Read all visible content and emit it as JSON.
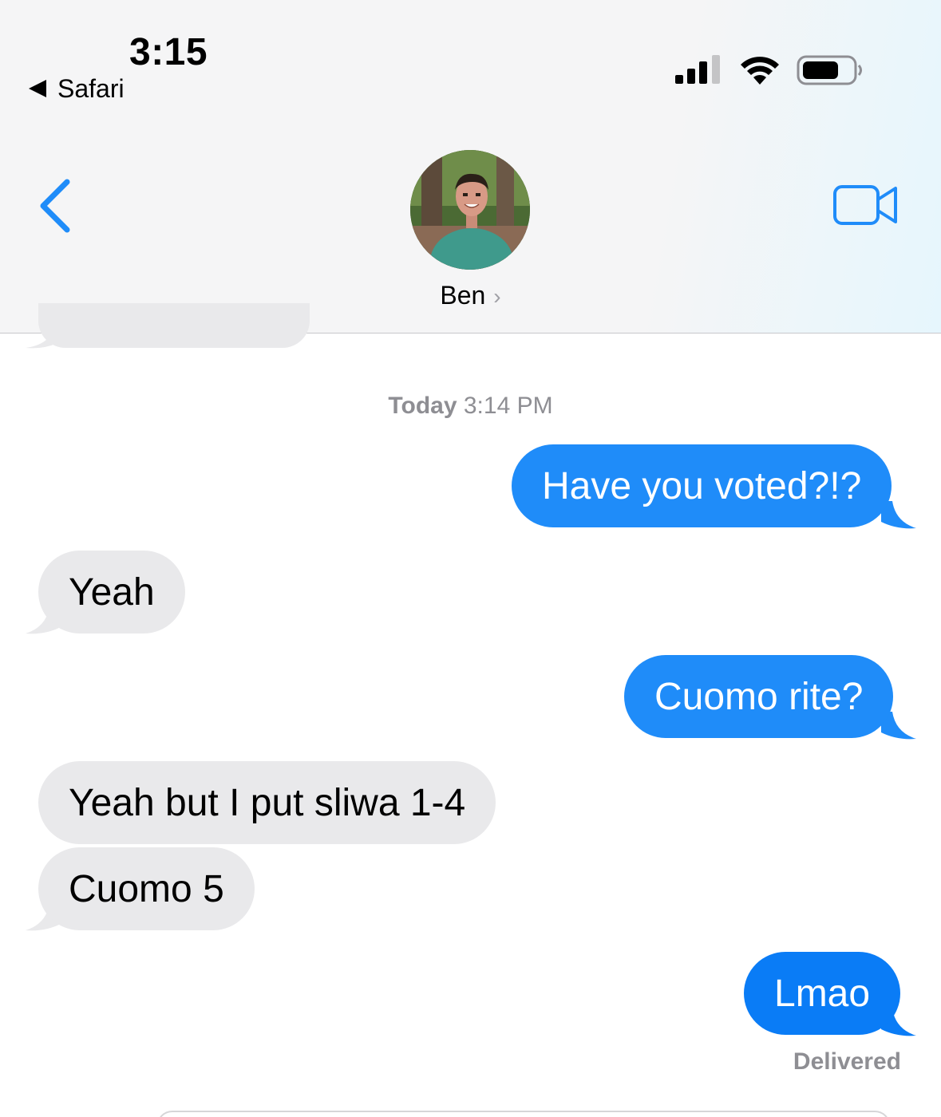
{
  "status_bar": {
    "time": "3:15",
    "back_app_label": "Safari",
    "icons": [
      "cellular-signal-icon",
      "wifi-icon",
      "battery-icon"
    ]
  },
  "nav": {
    "back_icon": "chevron-left-icon",
    "contact_name": "Ben",
    "contact_chevron": "›",
    "video_icon": "video-camera-icon"
  },
  "colors": {
    "accent": "#1f8cf9",
    "incoming_bubble": "#e9e9eb",
    "meta_text": "#8e8e93"
  },
  "conversation": {
    "timestamp_day": "Today",
    "timestamp_time": "3:14 PM",
    "messages": [
      {
        "direction": "outgoing",
        "text": "Have you voted?!?"
      },
      {
        "direction": "incoming",
        "text": "Yeah"
      },
      {
        "direction": "outgoing",
        "text": "Cuomo rite?"
      },
      {
        "direction": "incoming",
        "text": "Yeah but I put sliwa 1-4"
      },
      {
        "direction": "incoming",
        "text": "Cuomo 5"
      },
      {
        "direction": "outgoing",
        "text": "Lmao"
      }
    ],
    "delivery_status": "Delivered"
  }
}
